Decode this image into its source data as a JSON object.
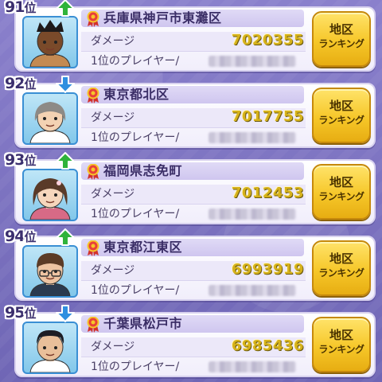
{
  "ranking_list": [
    {
      "rank": "91",
      "rank_unit": "位",
      "trend": "up",
      "region": "兵庫県神戸市東灘区",
      "damage_label": "ダメージ",
      "damage_value": "7020355",
      "top_player_label": "1位のプレイヤー/",
      "button_line1": "地区",
      "button_line2": "ランキング",
      "avatar": "dark-skinned-boy-avatar"
    },
    {
      "rank": "92",
      "rank_unit": "位",
      "trend": "down",
      "region": "東京都北区",
      "damage_label": "ダメージ",
      "damage_value": "7017755",
      "top_player_label": "1位のプレイヤー/",
      "button_line1": "地区",
      "button_line2": "ランキング",
      "avatar": "gray-haired-woman-avatar"
    },
    {
      "rank": "93",
      "rank_unit": "位",
      "trend": "up",
      "region": "福岡県志免町",
      "damage_label": "ダメージ",
      "damage_value": "7012453",
      "top_player_label": "1位のプレイヤー/",
      "button_line1": "地区",
      "button_line2": "ランキング",
      "avatar": "brown-haired-girl-avatar"
    },
    {
      "rank": "94",
      "rank_unit": "位",
      "trend": "up",
      "region": "東京都江東区",
      "damage_label": "ダメージ",
      "damage_value": "6993919",
      "top_player_label": "1位のプレイヤー/",
      "button_line1": "地区",
      "button_line2": "ランキング",
      "avatar": "glasses-man-avatar"
    },
    {
      "rank": "95",
      "rank_unit": "位",
      "trend": "down",
      "region": "千葉県松戸市",
      "damage_label": "ダメージ",
      "damage_value": "6985436",
      "top_player_label": "1位のプレイヤー/",
      "button_line1": "地区",
      "button_line2": "ランキング",
      "avatar": "black-haired-boy-avatar"
    }
  ],
  "colors": {
    "trend_up": "#2fb33a",
    "trend_down": "#2f8fe0",
    "damage_gold": "#d6b21a",
    "button_gold": "#f6c729"
  }
}
